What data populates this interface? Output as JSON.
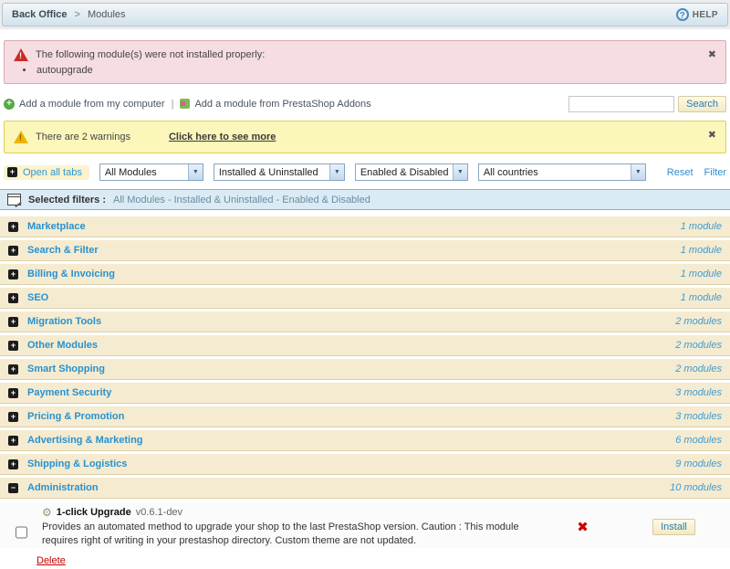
{
  "header": {
    "breadcrumb_root": "Back Office",
    "breadcrumb_sep": ">",
    "breadcrumb_current": "Modules",
    "help_label": "HELP"
  },
  "error_banner": {
    "message": "The following module(s) were not installed properly:",
    "items": [
      "autoupgrade"
    ]
  },
  "add_row": {
    "from_computer": "Add a module from my computer",
    "separator": "|",
    "from_addons": "Add a module from PrestaShop Addons",
    "search_value": "",
    "search_button": "Search"
  },
  "warning_banner": {
    "message": "There are 2 warnings",
    "link": "Click here to see more"
  },
  "filter_bar": {
    "open_all_tabs": "Open all tabs",
    "selects": [
      {
        "value": "All Modules"
      },
      {
        "value": "Installed & Uninstalled"
      },
      {
        "value": "Enabled & Disabled"
      },
      {
        "value": "All countries"
      }
    ],
    "reset_label": "Reset",
    "filter_label": "Filter"
  },
  "selected_filters": {
    "label": "Selected filters :",
    "value": "All Modules - Installed & Uninstalled - Enabled & Disabled"
  },
  "categories": [
    {
      "label": "Marketplace",
      "count": "1 module",
      "expanded": false
    },
    {
      "label": "Search & Filter",
      "count": "1 module",
      "expanded": false
    },
    {
      "label": "Billing & Invoicing",
      "count": "1 module",
      "expanded": false
    },
    {
      "label": "SEO",
      "count": "1 module",
      "expanded": false
    },
    {
      "label": "Migration Tools",
      "count": "2 modules",
      "expanded": false
    },
    {
      "label": "Other Modules",
      "count": "2 modules",
      "expanded": false
    },
    {
      "label": "Smart Shopping",
      "count": "2 modules",
      "expanded": false
    },
    {
      "label": "Payment Security",
      "count": "3 modules",
      "expanded": false
    },
    {
      "label": "Pricing & Promotion",
      "count": "3 modules",
      "expanded": false
    },
    {
      "label": "Advertising & Marketing",
      "count": "6 modules",
      "expanded": false
    },
    {
      "label": "Shipping & Logistics",
      "count": "9 modules",
      "expanded": false
    },
    {
      "label": "Administration",
      "count": "10 modules",
      "expanded": true
    }
  ],
  "module_panel": {
    "title": "1-click Upgrade",
    "version": "v0.6.1-dev",
    "description": "Provides an automated method to upgrade your shop to the last PrestaShop version. Caution : This module requires right of writing in your prestashop directory. Custom theme are not updated.",
    "install_button": "Install",
    "delete_link": "Delete"
  },
  "icons": {
    "help": "?",
    "close": "✖",
    "warning_mark": "!",
    "plus": "+",
    "minus": "−",
    "select_arrow": "▼",
    "gear": "⚙",
    "status_error": "✖"
  },
  "colors": {
    "accent_blue": "#2792d0",
    "error_bg": "#f5dde1",
    "warning_bg": "#fbf6ba",
    "category_bg": "#f5ebd0",
    "status_error": "#cc0000"
  }
}
